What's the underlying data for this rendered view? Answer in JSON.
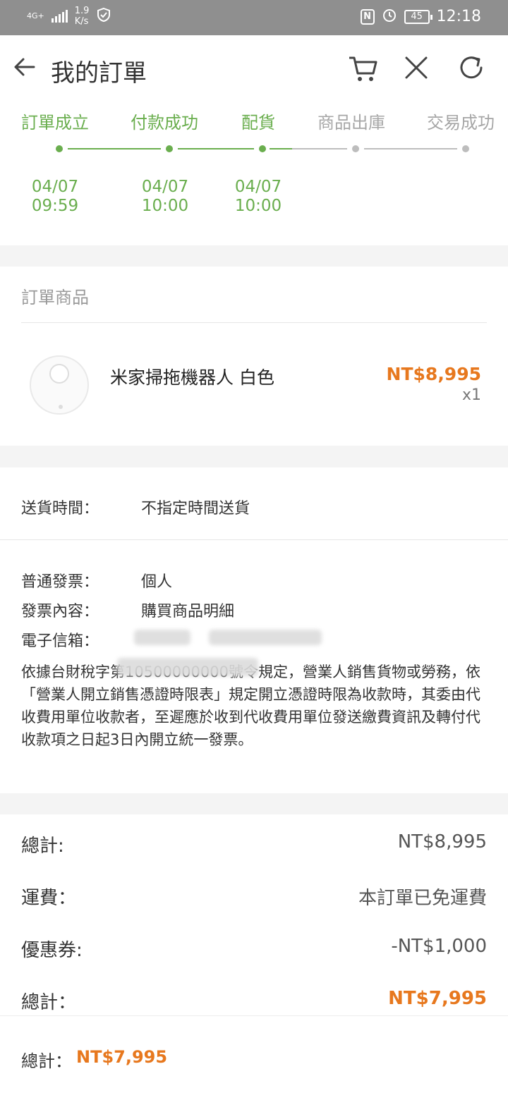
{
  "status_bar": {
    "network": "4G+",
    "speed_value": "1.9",
    "speed_unit": "K/s",
    "nfc": "N",
    "battery": "45",
    "time": "12:18"
  },
  "header": {
    "title": "我的訂單",
    "icons": [
      "back-arrow-icon",
      "cart-icon",
      "close-icon",
      "refresh-icon"
    ]
  },
  "progress": {
    "steps": [
      {
        "label": "訂單成立",
        "date": "04/07",
        "time": "09:59",
        "done": true
      },
      {
        "label": "付款成功",
        "date": "04/07",
        "time": "10:00",
        "done": true
      },
      {
        "label": "配貨",
        "date": "04/07",
        "time": "10:00",
        "done": true
      },
      {
        "label": "商品出庫",
        "done": false
      },
      {
        "label": "交易成功",
        "done": false
      }
    ],
    "colors": {
      "done": "#6aae4e",
      "pending": "#a6a6a6"
    }
  },
  "order_items": {
    "title": "訂單商品",
    "item": {
      "name": "米家掃拖機器人 白色",
      "price": "NT$8,995",
      "qty": "x1"
    }
  },
  "delivery": {
    "label": "送貨時間：",
    "value": "不指定時間送貨"
  },
  "invoice": {
    "type_label": "普通發票：",
    "type_value": "個人",
    "content_label": "發票內容：",
    "content_value": "購買商品明細",
    "email_label": "電子信箱：",
    "notice": "依據台財稅字第10500000000號令規定，營業人銷售貨物或勞務，依「營業人開立銷售憑證時限表」規定開立憑證時限為收款時，其委由代收費用單位收款者，至遲應於收到代收費用單位發送繳費資訊及轉付代收款項之日起3日內開立統一發票。"
  },
  "summary": {
    "subtotal_label": "總計:",
    "subtotal_value": "NT$8,995",
    "shipping_label": "運費：",
    "shipping_value": "本訂單已免運費",
    "coupon_label": "優惠券:",
    "coupon_value": "-NT$1,000",
    "total_label": "總計：",
    "total_value": "NT$7,995"
  },
  "bottom_bar": {
    "label": "總計：",
    "total": "NT$7,995"
  },
  "colors": {
    "accent_orange": "#e7781e",
    "accent_green": "#6aae4e"
  }
}
